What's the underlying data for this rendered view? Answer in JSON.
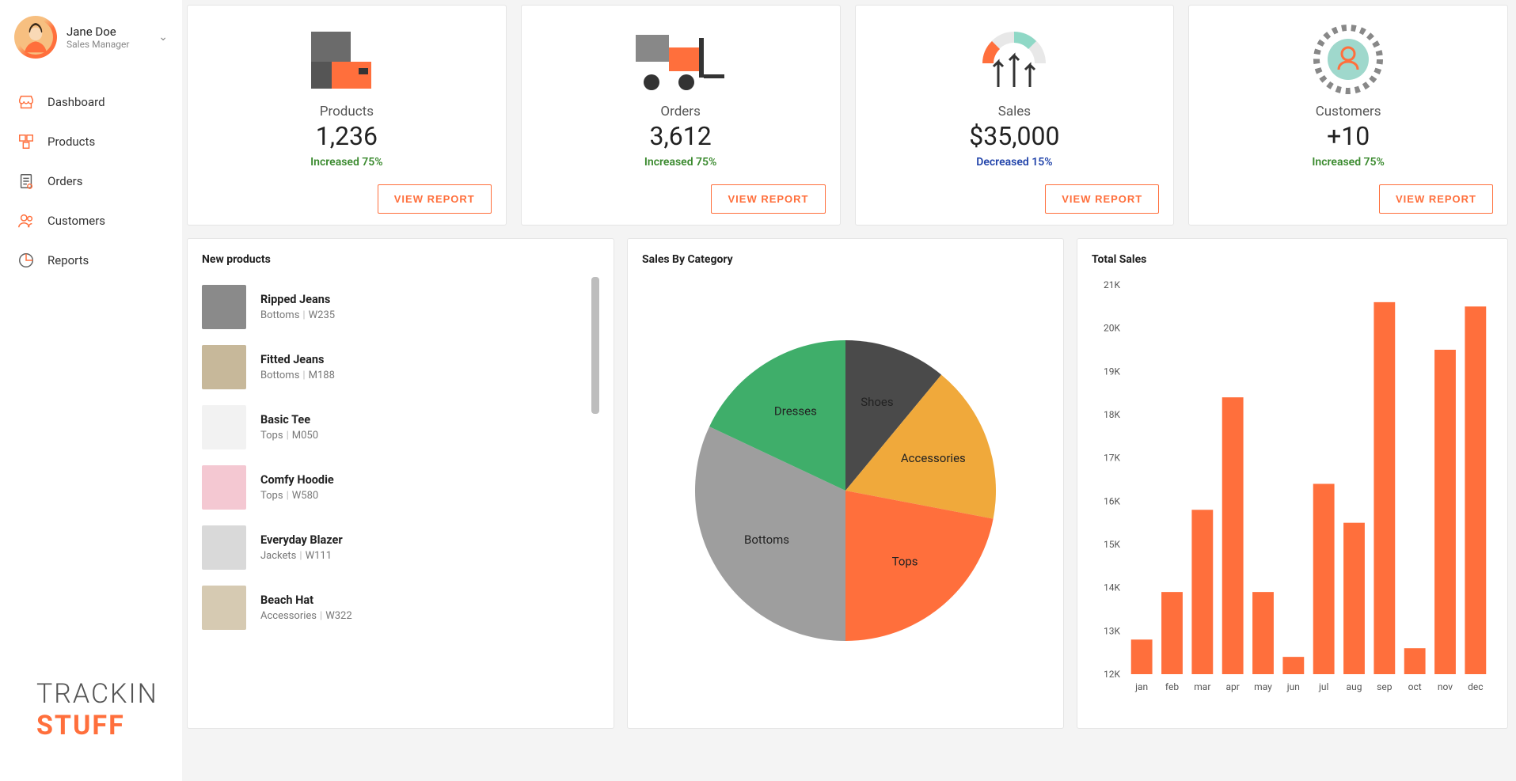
{
  "user": {
    "name": "Jane Doe",
    "role": "Sales Manager"
  },
  "nav": {
    "items": [
      {
        "label": "Dashboard"
      },
      {
        "label": "Products"
      },
      {
        "label": "Orders"
      },
      {
        "label": "Customers"
      },
      {
        "label": "Reports"
      }
    ]
  },
  "logo": {
    "line1": "TRACKIN",
    "line2": "STUFF"
  },
  "stat_cards": [
    {
      "label": "Products",
      "value": "1,236",
      "trend": "Increased 75%",
      "trend_dir": "up",
      "button": "VIEW REPORT"
    },
    {
      "label": "Orders",
      "value": "3,612",
      "trend": "Increased 75%",
      "trend_dir": "up",
      "button": "VIEW REPORT"
    },
    {
      "label": "Sales",
      "value": "$35,000",
      "trend": "Decreased 15%",
      "trend_dir": "down",
      "button": "VIEW REPORT"
    },
    {
      "label": "Customers",
      "value": "+10",
      "trend": "Increased 75%",
      "trend_dir": "up",
      "button": "VIEW REPORT"
    }
  ],
  "panels": {
    "new_products": {
      "title": "New products",
      "items": [
        {
          "name": "Ripped Jeans",
          "category": "Bottoms",
          "sku": "W235"
        },
        {
          "name": "Fitted Jeans",
          "category": "Bottoms",
          "sku": "M188"
        },
        {
          "name": "Basic Tee",
          "category": "Tops",
          "sku": "M050"
        },
        {
          "name": "Comfy Hoodie",
          "category": "Tops",
          "sku": "W580"
        },
        {
          "name": "Everyday Blazer",
          "category": "Jackets",
          "sku": "W111"
        },
        {
          "name": "Beach Hat",
          "category": "Accessories",
          "sku": "W322"
        }
      ]
    },
    "sales_by_category": {
      "title": "Sales By Category"
    },
    "total_sales": {
      "title": "Total Sales"
    }
  },
  "chart_data": [
    {
      "type": "pie",
      "title": "Sales By Category",
      "series": [
        {
          "name": "Shoes",
          "value": 11,
          "color": "#4a4a4a"
        },
        {
          "name": "Accessories",
          "value": 17,
          "color": "#f0a93b"
        },
        {
          "name": "Tops",
          "value": 22,
          "color": "#ff6f3c"
        },
        {
          "name": "Bottoms",
          "value": 32,
          "color": "#9e9e9e"
        },
        {
          "name": "Dresses",
          "value": 18,
          "color": "#3fae6a"
        }
      ]
    },
    {
      "type": "bar",
      "title": "Total Sales",
      "ylabel": "",
      "xlabel": "",
      "ylim": [
        12000,
        21000
      ],
      "y_ticks": [
        "12K",
        "13K",
        "14K",
        "15K",
        "16K",
        "17K",
        "18K",
        "19K",
        "20K",
        "21K"
      ],
      "categories": [
        "jan",
        "feb",
        "mar",
        "apr",
        "may",
        "jun",
        "jul",
        "aug",
        "sep",
        "oct",
        "nov",
        "dec"
      ],
      "values": [
        12800,
        13900,
        15800,
        18400,
        13900,
        12400,
        16400,
        15500,
        20600,
        12600,
        19500,
        20500
      ]
    }
  ],
  "colors": {
    "accent": "#ff6f3c",
    "up": "#3a8a2e",
    "down": "#2244aa"
  }
}
